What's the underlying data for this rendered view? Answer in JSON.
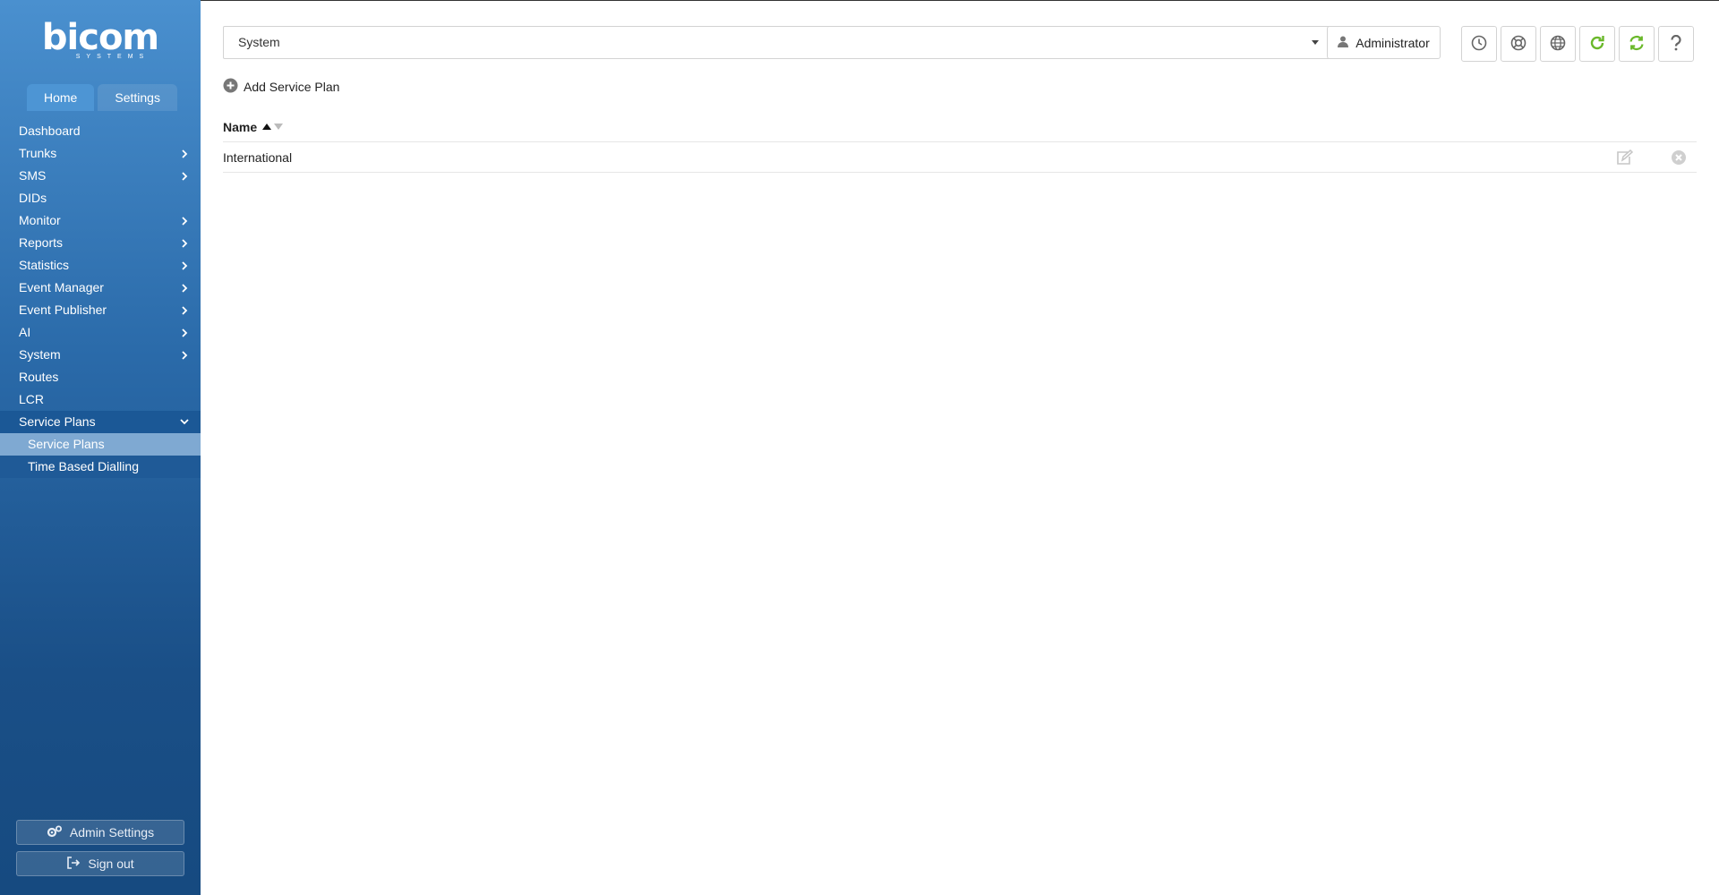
{
  "logo": {
    "name": "bicom",
    "sub": "SYSTEMS"
  },
  "tabs": [
    {
      "label": "Home",
      "active": true
    },
    {
      "label": "Settings",
      "active": false
    }
  ],
  "nav": {
    "items": [
      {
        "label": "Dashboard",
        "chevron": false
      },
      {
        "label": "Trunks",
        "chevron": true
      },
      {
        "label": "SMS",
        "chevron": true
      },
      {
        "label": "DIDs",
        "chevron": false
      },
      {
        "label": "Monitor",
        "chevron": true
      },
      {
        "label": "Reports",
        "chevron": true
      },
      {
        "label": "Statistics",
        "chevron": true
      },
      {
        "label": "Event Manager",
        "chevron": true
      },
      {
        "label": "Event Publisher",
        "chevron": true
      },
      {
        "label": "AI",
        "chevron": true
      },
      {
        "label": "System",
        "chevron": true
      },
      {
        "label": "Routes",
        "chevron": false
      },
      {
        "label": "LCR",
        "chevron": false
      },
      {
        "label": "Service Plans",
        "chevron": true,
        "open": true
      }
    ],
    "sub_items": [
      {
        "label": "Service Plans",
        "active": true
      },
      {
        "label": "Time Based Dialling",
        "active": false
      }
    ]
  },
  "sidebar_buttons": {
    "admin_settings": "Admin Settings",
    "sign_out": "Sign out"
  },
  "header": {
    "tenant_select": "System",
    "user_button": "Administrator",
    "icon_buttons": [
      "clock-icon",
      "lifebuoy-icon",
      "globe-icon",
      "reload-icon",
      "sync-icon",
      "help-icon"
    ]
  },
  "toolbar": {
    "add_label": "Add Service Plan"
  },
  "table": {
    "columns": [
      "Name"
    ],
    "rows": [
      {
        "name": "International"
      }
    ]
  },
  "colors": {
    "accent_green": "#6ab82a",
    "sidebar_top": "#4a90cf",
    "sidebar_bottom": "#164a80"
  }
}
